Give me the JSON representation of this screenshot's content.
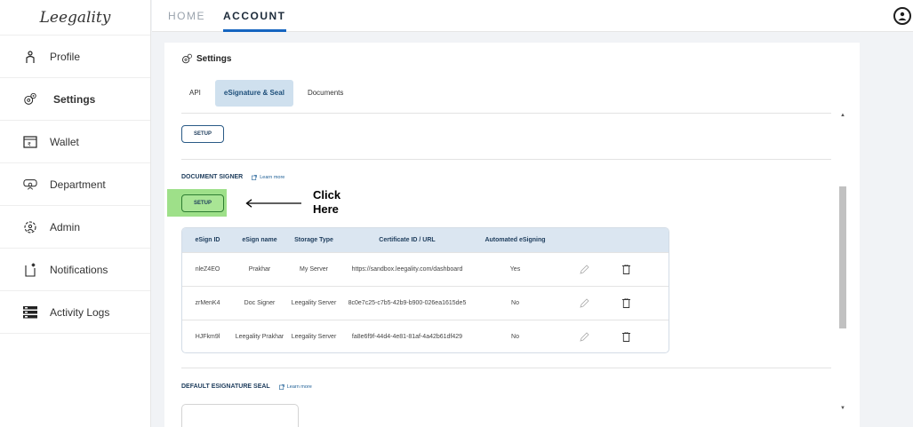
{
  "app": {
    "logo_text": "Leegality"
  },
  "sidebar": {
    "items": [
      {
        "label": "Profile",
        "icon": "person-icon"
      },
      {
        "label": "Settings",
        "icon": "gears-icon"
      },
      {
        "label": "Wallet",
        "icon": "wallet-icon"
      },
      {
        "label": "Department",
        "icon": "department-icon"
      },
      {
        "label": "Admin",
        "icon": "admin-gear-icon"
      },
      {
        "label": "Notifications",
        "icon": "bell-icon"
      },
      {
        "label": "Activity Logs",
        "icon": "logs-icon"
      }
    ]
  },
  "topnav": {
    "home": "HOME",
    "account": "ACCOUNT"
  },
  "panel": {
    "title": "Settings",
    "tabs": [
      "API",
      "eSignature & Seal",
      "Documents"
    ],
    "setup_label": "SETUP",
    "document_signer": {
      "label": "DOCUMENT SIGNER",
      "learn_more": "Learn more"
    },
    "default_seal": {
      "label": "DEFAULT ESIGNATURE SEAL",
      "learn_more": "Learn more"
    },
    "annotation": {
      "line1": "Click",
      "line2": "Here"
    },
    "table": {
      "headers": [
        "eSign ID",
        "eSign name",
        "Storage Type",
        "Certificate ID / URL",
        "Automated eSigning"
      ],
      "rows": [
        {
          "id": "nleZ4EO",
          "name": "Prakhar",
          "storage": "My Server",
          "cert": "https://sandbox.leegality.com/dashboard",
          "auto": "Yes"
        },
        {
          "id": "zrMenK4",
          "name": "Doc Signer",
          "storage": "Leegality Server",
          "cert": "8c0e7c25-c7b5-42b9-b900-026ea1615de5",
          "auto": "No"
        },
        {
          "id": "HJFkm9l",
          "name": "Leegality Prakhar",
          "storage": "Leegality Server",
          "cert": "fa8e6f9f-44d4-4e81-81af-4a42b61df429",
          "auto": "No"
        }
      ]
    }
  },
  "colors": {
    "accent": "#1565c0",
    "highlight": "#9ee089",
    "table_header": "#dbe6f1",
    "active_tab": "#cfe0ee"
  }
}
